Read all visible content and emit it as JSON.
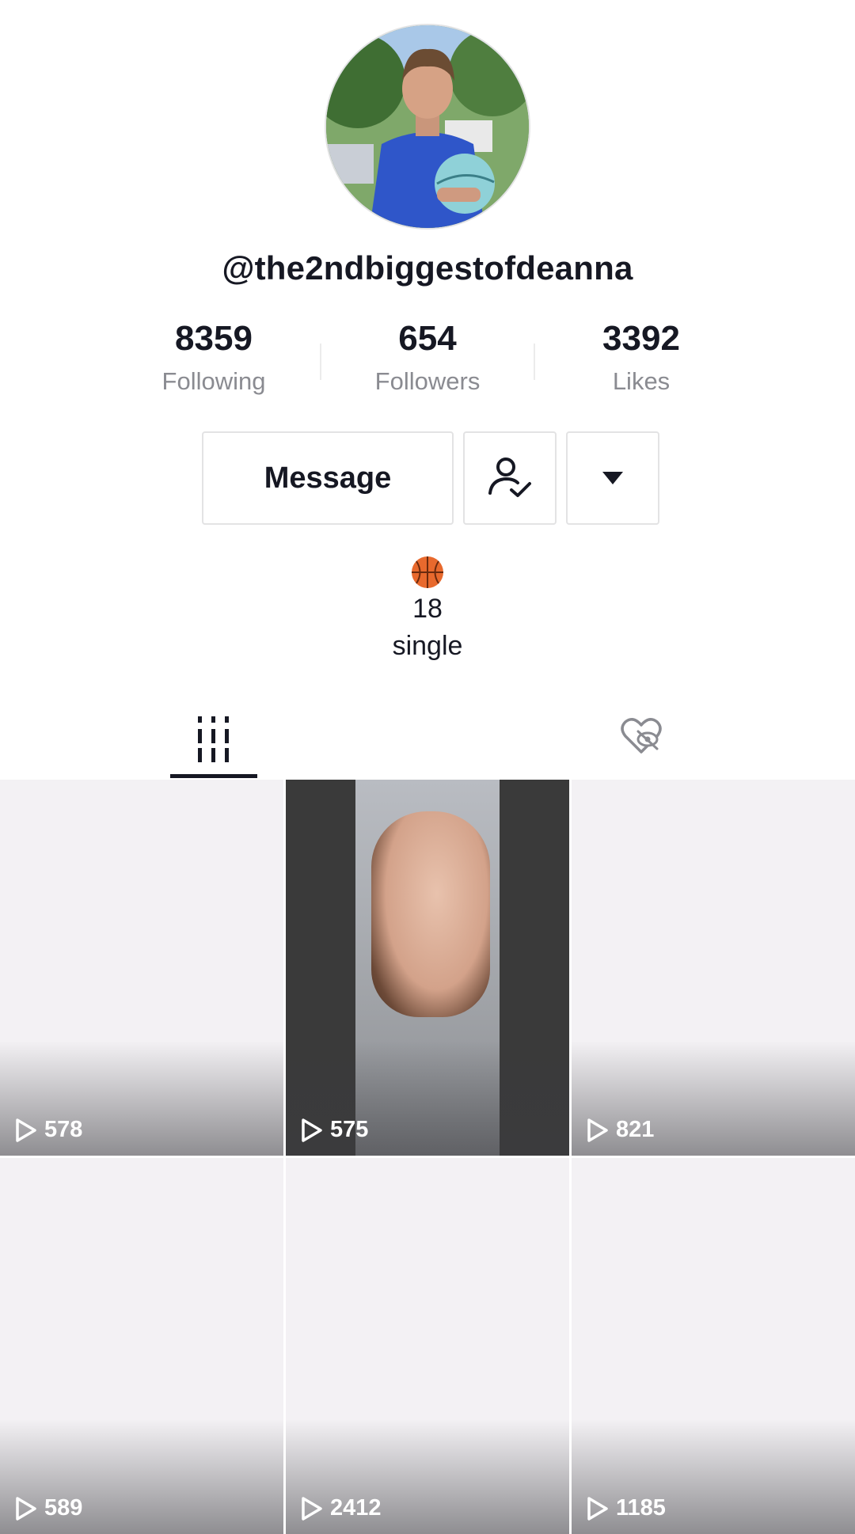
{
  "profile": {
    "username": "@the2ndbiggestofdeanna",
    "avatar_alt": "avatar"
  },
  "stats": [
    {
      "value": "8359",
      "label": "Following"
    },
    {
      "value": "654",
      "label": "Followers"
    },
    {
      "value": "3392",
      "label": "Likes"
    }
  ],
  "actions": {
    "message_label": "Message",
    "follow_icon": "user-check-icon",
    "more_icon": "caret-down-icon"
  },
  "bio": {
    "emoji_icon": "basketball-icon",
    "line1": "18",
    "line2": "single"
  },
  "tabs": [
    {
      "icon": "videos-grid-icon",
      "active": true
    },
    {
      "icon": "liked-hidden-icon",
      "active": false
    }
  ],
  "videos": [
    {
      "views": "578"
    },
    {
      "views": "575"
    },
    {
      "views": "821"
    },
    {
      "views": "589"
    },
    {
      "views": "2412"
    },
    {
      "views": "1185"
    }
  ]
}
